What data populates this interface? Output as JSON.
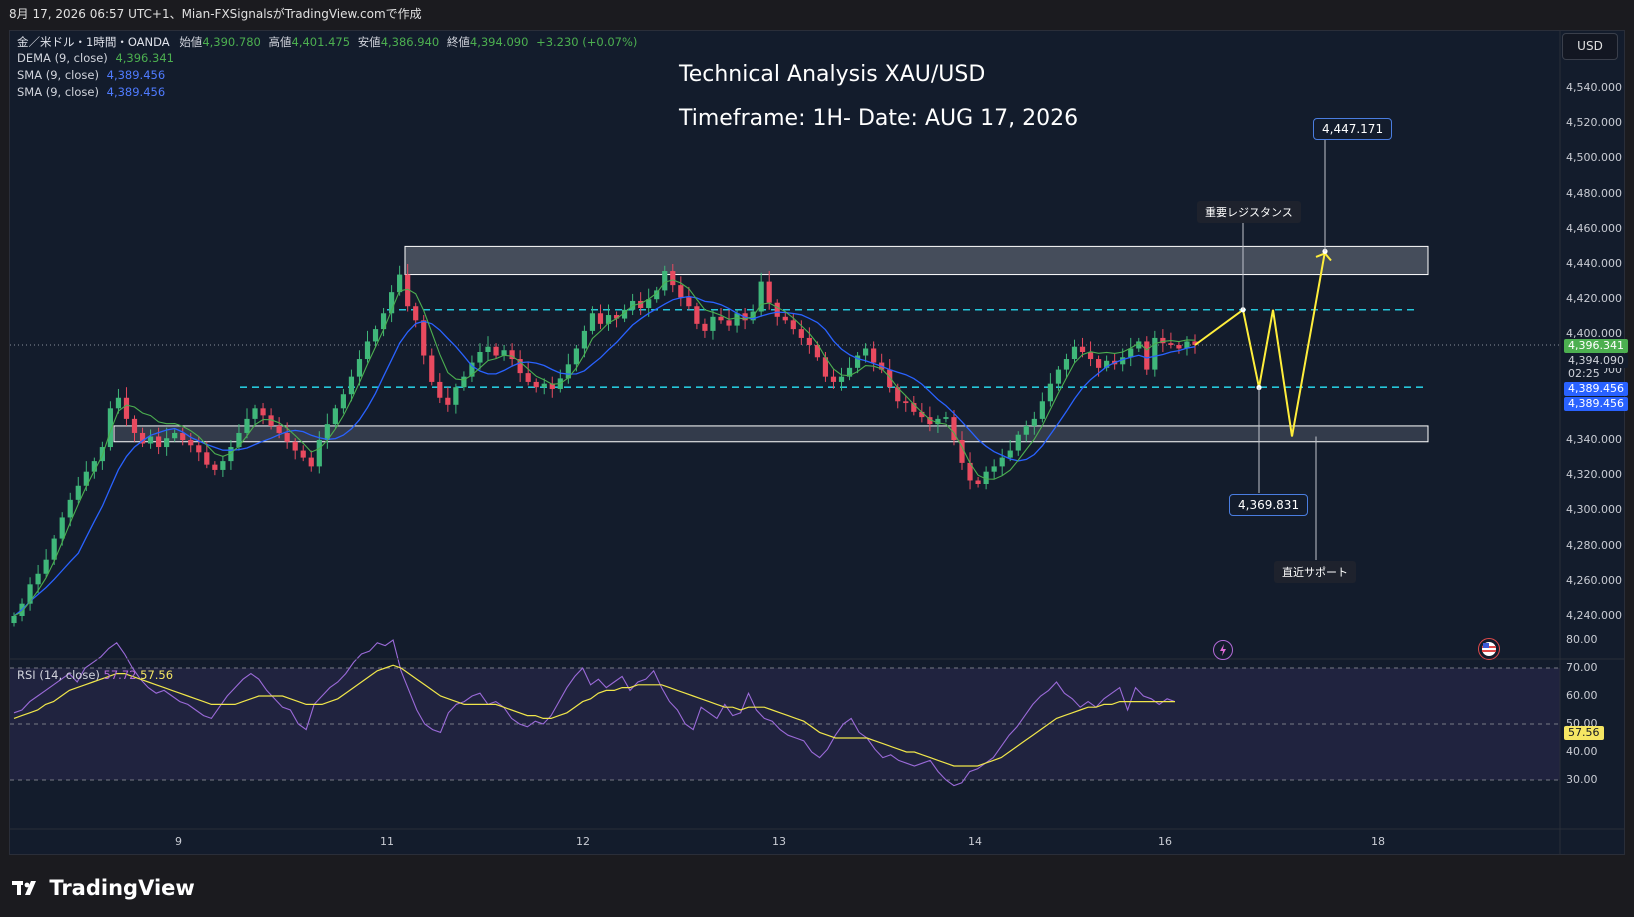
{
  "topbar": {
    "text": "8月 17, 2026 06:57 UTC+1、Mian-FXSignalsがTradingView.comで作成"
  },
  "legend": {
    "symbol": "金／米ドル・1時間・OANDA",
    "open_label": "始値",
    "open_value": "4,390.780",
    "high_label": "高値",
    "high_value": "4,401.475",
    "low_label": "安値",
    "low_value": "4,386.940",
    "close_label": "終値",
    "close_value": "4,394.090",
    "change": "+3.230 (+0.07%)",
    "indicators": [
      {
        "name": "DEMA (9, close)",
        "value": "4,396.341",
        "color": "#4caf50"
      },
      {
        "name": "SMA (9, close)",
        "value": "4,389.456",
        "color": "#2962ff"
      },
      {
        "name": "SMA (9, close)",
        "value": "4,389.456",
        "color": "#2962ff"
      }
    ]
  },
  "currency": "USD",
  "title_line1": "Technical Analysis XAU/USD",
  "title_line2": "Timeframe: 1H- Date: AUG 17, 2026",
  "annotations": {
    "target": "4,447.171",
    "resistance_note": "重要レジスタンス",
    "pullback": "4,369.831",
    "support_note": "直近サポート"
  },
  "price_tags": {
    "dema": "4,396.341",
    "last": "4,394.090",
    "countdown": "02:25",
    "sma1": "4,389.456",
    "sma2": "4,389.456"
  },
  "rsi": {
    "label": "RSI (14, close)",
    "value": "57.72",
    "ma_value": "57.56",
    "tag": "57.56"
  },
  "brand": {
    "name": "TradingView"
  },
  "chart_data": {
    "type": "candlestick",
    "symbol": "XAU/USD",
    "timeframe": "1H",
    "y_range": [
      4230,
      4550
    ],
    "y_ticks": [
      4240,
      4260,
      4280,
      4300,
      4320,
      4340,
      4360,
      4380,
      4400,
      4420,
      4440,
      4460,
      4480,
      4500,
      4520,
      4540
    ],
    "x_ticks": [
      "9",
      "11",
      "12",
      "13",
      "14",
      "16",
      "18"
    ],
    "close_series": [
      4240,
      4247,
      4258,
      4264,
      4272,
      4284,
      4296,
      4306,
      4314,
      4322,
      4328,
      4336,
      4358,
      4364,
      4352,
      4344,
      4338,
      4342,
      4336,
      4341,
      4344,
      4340,
      4337,
      4333,
      4326,
      4323,
      4328,
      4336,
      4344,
      4352,
      4358,
      4354,
      4348,
      4344,
      4339,
      4334,
      4330,
      4325,
      4340,
      4349,
      4358,
      4366,
      4376,
      4386,
      4396,
      4403,
      4412,
      4424,
      4434,
      4416,
      4408,
      4388,
      4373,
      4364,
      4360,
      4370,
      4376,
      4384,
      4390,
      4393,
      4388,
      4391,
      4386,
      4378,
      4373,
      4370,
      4372,
      4369,
      4375,
      4383,
      4392,
      4402,
      4412,
      4406,
      4411,
      4409,
      4414,
      4419,
      4415,
      4420,
      4425,
      4436,
      4428,
      4421,
      4416,
      4406,
      4402,
      4410,
      4408,
      4405,
      4412,
      4408,
      4413,
      4430,
      4418,
      4410,
      4408,
      4403,
      4398,
      4394,
      4387,
      4376,
      4373,
      4376,
      4381,
      4388,
      4392,
      4384,
      4380,
      4370,
      4362,
      4361,
      4356,
      4353,
      4349,
      4352,
      4353,
      4340,
      4327,
      4317,
      4315,
      4322,
      4325,
      4330,
      4334,
      4343,
      4348,
      4352,
      4362,
      4372,
      4380,
      4386,
      4393,
      4390,
      4386,
      4381,
      4385,
      4383,
      4387,
      4392,
      4396,
      4380,
      4398,
      4395,
      4394,
      4392,
      4396,
      4394
    ],
    "levels": {
      "resistance_zone": [
        4434,
        4450
      ],
      "support_zone": [
        4339,
        4348
      ],
      "dashed_upper": 4414,
      "dashed_lower": 4370
    },
    "projection": [
      4394,
      4414,
      4369.831,
      4414,
      4342,
      4447.171
    ],
    "rsi": {
      "y_range": [
        25,
        80
      ],
      "y_ticks": [
        30,
        40,
        50,
        60,
        70,
        80
      ],
      "levels": [
        30,
        50,
        70
      ],
      "values": [
        54,
        55,
        58,
        60,
        62,
        64,
        66,
        68,
        65,
        70,
        72,
        74,
        77,
        79,
        75,
        70,
        66,
        63,
        61,
        62,
        60,
        58,
        57,
        55,
        53,
        52,
        56,
        60,
        63,
        66,
        68,
        66,
        62,
        59,
        56,
        55,
        50,
        48,
        57,
        60,
        63,
        65,
        68,
        72,
        75,
        76,
        79,
        78,
        80,
        69,
        62,
        55,
        50,
        48,
        47,
        54,
        57,
        58,
        60,
        61,
        57,
        58,
        56,
        52,
        50,
        49,
        51,
        50,
        53,
        58,
        63,
        67,
        70,
        64,
        66,
        63,
        65,
        67,
        62,
        65,
        66,
        69,
        63,
        58,
        55,
        50,
        48,
        56,
        54,
        52,
        57,
        53,
        54,
        61,
        55,
        52,
        51,
        48,
        46,
        45,
        44,
        40,
        38,
        41,
        46,
        50,
        52,
        47,
        45,
        41,
        38,
        39,
        37,
        36,
        35,
        36,
        37,
        33,
        30,
        28,
        29,
        33,
        34,
        36,
        38,
        42,
        46,
        49,
        53,
        57,
        60,
        62,
        65,
        61,
        59,
        56,
        58,
        56,
        59,
        61,
        63,
        55,
        63,
        60,
        59,
        57,
        59,
        58
      ],
      "ma_values": [
        52,
        53,
        54,
        55,
        57,
        58,
        60,
        62,
        63,
        64,
        65,
        66,
        67,
        68,
        68,
        67,
        66,
        65,
        64,
        63,
        62,
        61,
        60,
        59,
        58,
        57,
        57,
        57,
        57,
        58,
        59,
        60,
        60,
        60,
        60,
        59,
        58,
        57,
        57,
        57,
        58,
        59,
        61,
        63,
        65,
        67,
        69,
        70,
        71,
        70,
        68,
        66,
        64,
        62,
        60,
        59,
        58,
        57,
        57,
        57,
        57,
        57,
        56,
        55,
        54,
        53,
        53,
        52,
        52,
        53,
        54,
        56,
        58,
        59,
        61,
        62,
        62,
        63,
        63,
        64,
        64,
        64,
        64,
        63,
        62,
        61,
        60,
        59,
        58,
        57,
        56,
        56,
        55,
        56,
        56,
        56,
        55,
        54,
        53,
        52,
        51,
        49,
        47,
        46,
        45,
        45,
        45,
        45,
        45,
        44,
        43,
        42,
        41,
        40,
        40,
        39,
        38,
        37,
        36,
        35,
        35,
        35,
        35,
        36,
        37,
        38,
        40,
        42,
        44,
        46,
        48,
        50,
        52,
        53,
        54,
        55,
        56,
        56,
        57,
        57,
        58,
        58,
        58,
        58,
        58,
        58,
        58,
        58
      ]
    }
  }
}
